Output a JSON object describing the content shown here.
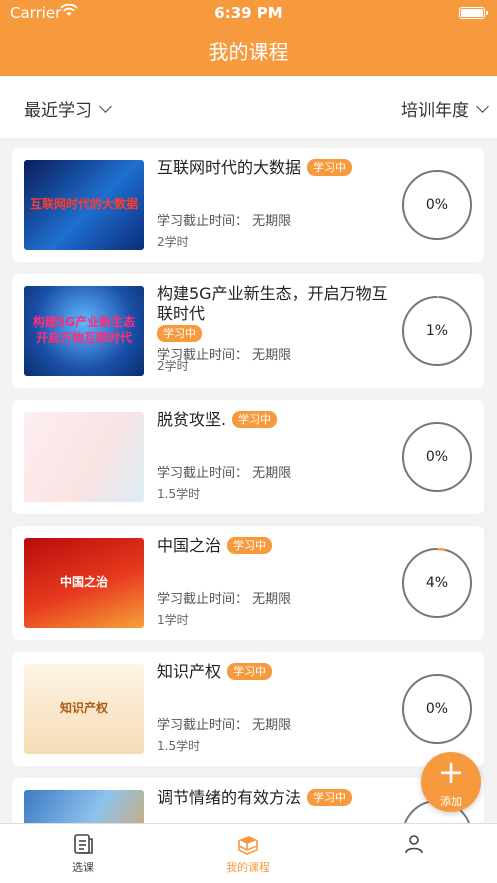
{
  "status": {
    "carrier": "Carrier",
    "time": "6:39 PM"
  },
  "header": {
    "title": "我的课程"
  },
  "filter": {
    "left_label": "最近学习",
    "right_label": "培训年度"
  },
  "courses": [
    {
      "title": "互联网时代的大数据",
      "badge": "学习中",
      "deadline": "学习截止时间： 无期限",
      "hours": "2学时",
      "progress_text": "0%",
      "progress": 0,
      "thumb_text": "互联网时代的大数据",
      "thumb_bg": "linear-gradient(135deg,#0a1f5c,#1e6fd0 55%,#0b2c7a)",
      "thumb_color": "#ff3b30"
    },
    {
      "title": "构建5G产业新生态，开启万物互联时代",
      "badge": "学习中",
      "deadline": "学习截止时间： 无期限",
      "hours": "2学时",
      "progress_text": "1%",
      "progress": 0.01,
      "thumb_text": "构建5G产业新生态\n开启万物互联时代",
      "thumb_bg": "radial-gradient(circle at 50% 40%,#5fb8ff,#1a4fa8 60%,#0c2d6b)",
      "thumb_color": "#ff2d7a"
    },
    {
      "title": "脱贫攻坚.",
      "badge": "学习中",
      "deadline": "学习截止时间： 无期限",
      "hours": "1.5学时",
      "progress_text": "0%",
      "progress": 0,
      "thumb_text": "",
      "thumb_bg": "linear-gradient(120deg,#fdeef0,#f9e3e3 60%,#d9eef6)",
      "thumb_color": "#d8282d"
    },
    {
      "title": "中国之治",
      "badge": "学习中",
      "deadline": "学习截止时间： 无期限",
      "hours": "1学时",
      "progress_text": "4%",
      "progress": 0.04,
      "thumb_text": "中国之治",
      "thumb_bg": "linear-gradient(160deg,#b80c0c,#e83a1e 55%,#f5a23a)",
      "thumb_color": "#ffffff"
    },
    {
      "title": "知识产权",
      "badge": "学习中",
      "deadline": "学习截止时间： 无期限",
      "hours": "1.5学时",
      "progress_text": "0%",
      "progress": 0,
      "thumb_text": "知识产权",
      "thumb_bg": "linear-gradient(180deg,#fdf4e6,#f6dcb5)",
      "thumb_color": "#b05a12"
    },
    {
      "title": "调节情绪的有效方法",
      "badge": "学习中",
      "deadline": "",
      "hours": "",
      "progress_text": "",
      "progress": 0,
      "thumb_text": "",
      "thumb_bg": "linear-gradient(120deg,#3c7ac4,#8fc2ec 50%,#e2a449)",
      "thumb_color": "#ffffff"
    }
  ],
  "fab": {
    "label": "添加"
  },
  "tabs": [
    {
      "label": "选课",
      "icon": "course-list-icon"
    },
    {
      "label": "我的课程",
      "icon": "book-icon"
    },
    {
      "label": "",
      "icon": "user-icon"
    }
  ],
  "colors": {
    "accent": "#f79a3e",
    "background": "#f2f2f2"
  }
}
